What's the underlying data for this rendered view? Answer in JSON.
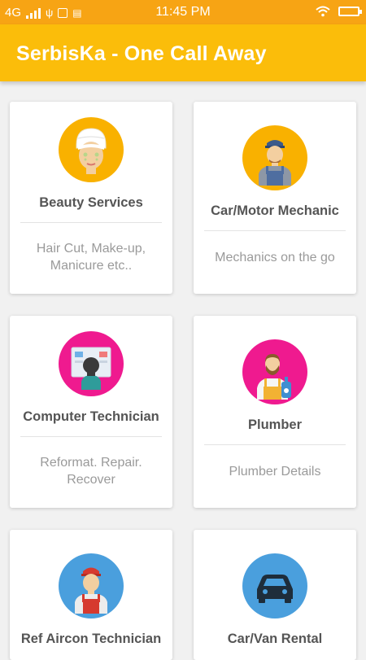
{
  "status_bar": {
    "network": "4G",
    "time": "11:45 PM"
  },
  "app_bar": {
    "title": "SerbisKa - One Call Away"
  },
  "colors": {
    "accent": "#fbbd0a",
    "status_bar": "#f7a414",
    "yellow_circle": "#f9b100",
    "pink_circle": "#ef1a8f",
    "blue_circle": "#4a9fdd"
  },
  "services": [
    {
      "title": "Beauty Services",
      "description": "Hair Cut, Make-up, Manicure etc..",
      "icon": "beauty-face-icon"
    },
    {
      "title": "Car/Motor Mechanic",
      "description": "Mechanics on the go",
      "icon": "mechanic-icon"
    },
    {
      "title": "Computer Technician",
      "description": "Reformat. Repair. Recover",
      "icon": "computer-technician-icon"
    },
    {
      "title": "Plumber",
      "description": "Plumber Details",
      "icon": "plumber-icon"
    },
    {
      "title": "Ref Aircon Technician",
      "description": "",
      "icon": "aircon-technician-icon"
    },
    {
      "title": "Car/Van Rental",
      "description": "",
      "icon": "car-icon"
    }
  ]
}
